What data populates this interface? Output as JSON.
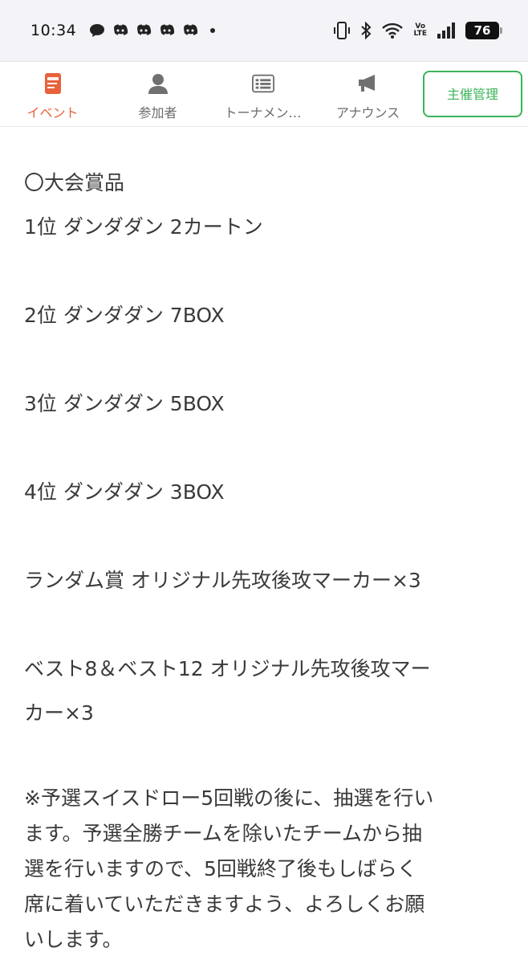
{
  "status_bar": {
    "time": "10:34",
    "notifications": [
      "chat-bubble-icon",
      "discord-icon",
      "discord-icon",
      "discord-icon",
      "discord-icon"
    ],
    "network_label_top": "Vo",
    "network_label_bottom": "LTE",
    "battery": "76"
  },
  "tabs": [
    {
      "label": "イベント",
      "icon": "event-icon",
      "active": true
    },
    {
      "label": "参加者",
      "icon": "person-icon",
      "active": false
    },
    {
      "label": "トーナメン…",
      "icon": "bracket-icon",
      "active": false
    },
    {
      "label": "アナウンス",
      "icon": "megaphone-icon",
      "active": false
    }
  ],
  "admin_button": "主催管理",
  "colors": {
    "accent": "#e8613a",
    "admin": "#3ab45a",
    "text": "#3a3a3a"
  },
  "content": {
    "heading": "〇大会賞品",
    "prize1": "1位 ダンダダン 2カートン",
    "prize2": "2位 ダンダダン 7BOX",
    "prize3": "3位 ダンダダン 5BOX",
    "prize4": "4位 ダンダダン 3BOX",
    "random_prize": "ランダム賞 オリジナル先攻後攻マーカー×3",
    "best_prize_line1": "ベスト8＆ベスト12 オリジナル先攻後攻マー",
    "best_prize_line2": "カー×3",
    "note_line1": "※予選スイスドロー5回戦の後に、抽選を行い",
    "note_line2": "ます。予選全勝チームを除いたチームから抽",
    "note_line3": "選を行いますので、5回戦終了後もしばらく",
    "note_line4": "席に着いていただきますよう、よろしくお願",
    "note_line5": "いします。"
  }
}
